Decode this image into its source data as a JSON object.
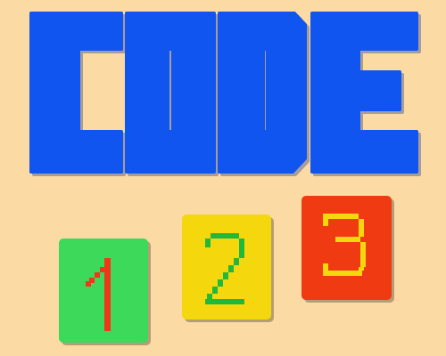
{
  "title": {
    "text": "CODE",
    "color": "#1055F0",
    "shadow_color": "#0A2C8A"
  },
  "tiles": [
    {
      "digit": "1",
      "background": "#3DD95A",
      "digit_color": "#F03818"
    },
    {
      "digit": "2",
      "background": "#F5D70D",
      "digit_color": "#22B83A"
    },
    {
      "digit": "3",
      "background": "#F03A12",
      "digit_color": "#F5D70D"
    }
  ]
}
